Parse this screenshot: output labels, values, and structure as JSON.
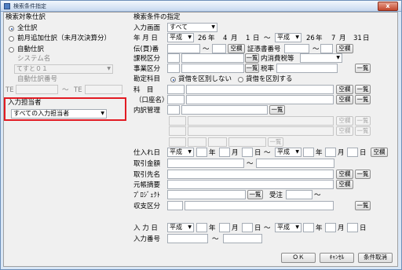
{
  "window": {
    "title": "検索条件指定",
    "close": "x"
  },
  "left": {
    "target_label": "検索対象仕訳",
    "radio_all": "全仕訳",
    "radio_prev": "前月追加仕訳（未月次決算分）",
    "radio_auto": "自動仕訳",
    "system_label": "システム名",
    "system_value": "てすと０１",
    "auto_no_label": "自動仕訳番号",
    "te1": "TE",
    "tilde": "～",
    "te2": "TE",
    "entry_person_label": "入力担当者",
    "entry_person_value": "すべての入力担当者"
  },
  "right": {
    "conditions_label": "検索条件の指定",
    "screen_label": "入力画面",
    "screen_value": "すべて",
    "ymd_label": "年 月 日",
    "era1": "平成",
    "y1": "26",
    "m1": "4",
    "d1": "1",
    "era2": "平成",
    "y2": "26",
    "m2": "7",
    "d2": "31",
    "year_unit": "年",
    "month_unit": "月",
    "day_unit": "日",
    "tilde": "～",
    "voucher_label": "伝(買)番",
    "blank_btn": "空欄",
    "blank_btn_short": "空欄",
    "list_btn": "一覧",
    "receipt_label": "証憑書番号",
    "tax_cat_label": "課税区分",
    "internal_tax_label": "内消費税等",
    "business_label": "事業区分",
    "tax_rate_label": "税率",
    "account_label": "勘定科目",
    "radio_nodist": "貸借を区別しない",
    "radio_dist": "貸借を区別する",
    "kamoku_label": "科　目",
    "kuchimei_label": "（口座名）",
    "naibu_label": "内訳管理",
    "shiire_label": "仕入れ日",
    "era3": "平成",
    "torihiki_kingaku_label": "取引金額",
    "torihikisaki_label": "取引先名",
    "motocho_label": "元帳摘要",
    "project_label": "ﾌﾟﾛｼﾞｪｸﾄ",
    "juchu_label": "受注",
    "shushi_label": "収支区分",
    "nyuryoku_label": "入 力 日",
    "era4": "平成",
    "nyuryoku_no_label": "入力番号"
  },
  "footer": {
    "ok": "ＯＫ",
    "cancel": "ｷｬﾝｾﾙ",
    "clear": "条件取消"
  }
}
